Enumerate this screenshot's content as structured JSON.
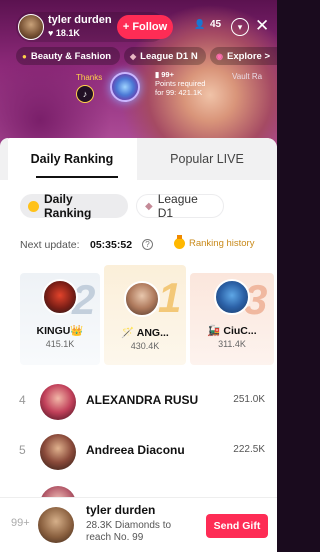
{
  "host": {
    "name": "tyler durden",
    "likes": "18.1K",
    "follow_label": "+ Follow",
    "viewers": "45"
  },
  "chips": [
    {
      "label": "Beauty & Fashion",
      "icon": "star-icon"
    },
    {
      "label": "League D1 N",
      "icon": "diamond-icon"
    },
    {
      "label": "Explore >",
      "icon": "compass-icon"
    }
  ],
  "stream_overlay": {
    "promo_label": "Thanks",
    "level": "99+",
    "points_text": "Points required for 99: 421.1K",
    "vault_label": "Vault Ra"
  },
  "tabs": {
    "daily": "Daily Ranking",
    "popular": "Popular LIVE"
  },
  "sub_tabs": {
    "daily": "Daily Ranking",
    "league": "League D1"
  },
  "update": {
    "label": "Next update:",
    "time": "05:35:52",
    "history_label": "Ranking history"
  },
  "podium": [
    {
      "rank": "2",
      "name": "KINGU👑",
      "score": "415.1K"
    },
    {
      "rank": "1",
      "name": "🪄 ANG...",
      "score": "430.4K"
    },
    {
      "rank": "3",
      "name": "🚂 CiuC...",
      "score": "311.4K"
    }
  ],
  "ranking_list": [
    {
      "rank": "4",
      "name": "ALEXANDRA RUSU",
      "score": "251.0K",
      "avatar_color": "#c1405a"
    },
    {
      "rank": "5",
      "name": "Andreea Diaconu",
      "score": "222.5K",
      "avatar_color": "#8a4a3a"
    },
    {
      "rank": "",
      "name": "",
      "score": "",
      "avatar_color": "#b45a6a"
    }
  ],
  "my_rank": {
    "rank": "99+",
    "name": "tyler durden",
    "subtitle": "28.3K Diamonds to reach No. 99",
    "send_gift": "Send Gift"
  },
  "colors": {
    "accent": "#fe2c55",
    "gold": "#ffc21a",
    "history": "#c98a1a"
  }
}
